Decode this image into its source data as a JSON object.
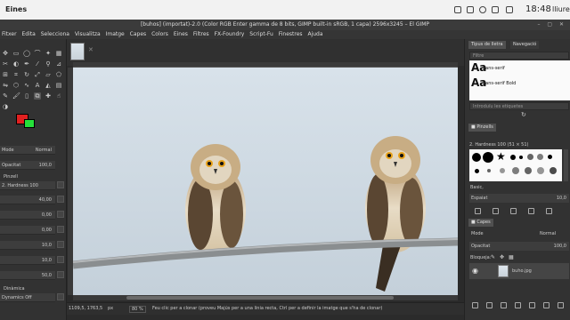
{
  "system_bar": {
    "label": "Eines",
    "clock": "18:48",
    "user": "lliure"
  },
  "window": {
    "title": "[buhos] (importat)-2.0 (Color RGB Enter gamma de 8 bits, GIMP built-in sRGB, 1 capa) 2596x3245 – El GIMP",
    "controls": "– ▢ ✕"
  },
  "menu": [
    "Fitxer",
    "Edita",
    "Selecciona",
    "Visualitza",
    "Imatge",
    "Capes",
    "Colors",
    "Eines",
    "Filtres",
    "FX-Foundry",
    "Script-Fu",
    "Finestres",
    "Ajuda"
  ],
  "tool_options": {
    "mode_label": "Mode",
    "mode_value": "Normal",
    "opacity_label": "Opacitat",
    "opacity_value": "100,0",
    "brush_label": "Pinzell",
    "brush_value": "2. Hardness 100",
    "size_value": "40,00",
    "aspect_value": "0,00",
    "angle_value": "0,00",
    "spacing_value": "10,0",
    "hardness_value": "10,0",
    "force_value": "50,0",
    "dynamics_label": "Dinàmica",
    "dynamics_value": "Dynamics Off"
  },
  "status": {
    "coords": "1109,5, 1763,5",
    "unit": "px",
    "zoom": "80 %",
    "message": "Feu clic per a clonar (proveu Majús per a una línia recta, Ctrl per a definir la imatge que s'ha de clonar)"
  },
  "right_dock": {
    "tabs": [
      "Tipus de lletra",
      "Navegació"
    ],
    "font_filter_placeholder": "Filtre",
    "fonts": [
      {
        "preview": "Aa",
        "name": "Sans-serif"
      },
      {
        "preview": "Aa",
        "name": "Sans-serif Bold"
      }
    ],
    "font_tags_placeholder": "Introduïu les etiquetes",
    "brushes_tab": "Pinzells",
    "brush_selected": "2. Hardness 100 (51 × 51)",
    "brush_tag": "Basic,",
    "spacing_label": "Espaiat",
    "spacing_value": "10,0",
    "layers_tab": "Capes",
    "layer_mode_label": "Mode",
    "layer_mode_value": "Normal",
    "layer_opacity_label": "Opacitat",
    "layer_opacity_value": "100,0",
    "lock_label": "Bloqueja:",
    "layer_name": "buho.jpg"
  },
  "colors": {
    "foreground": "#e02020",
    "background": "#25e03a",
    "ui_dark": "#2b2b2b"
  }
}
